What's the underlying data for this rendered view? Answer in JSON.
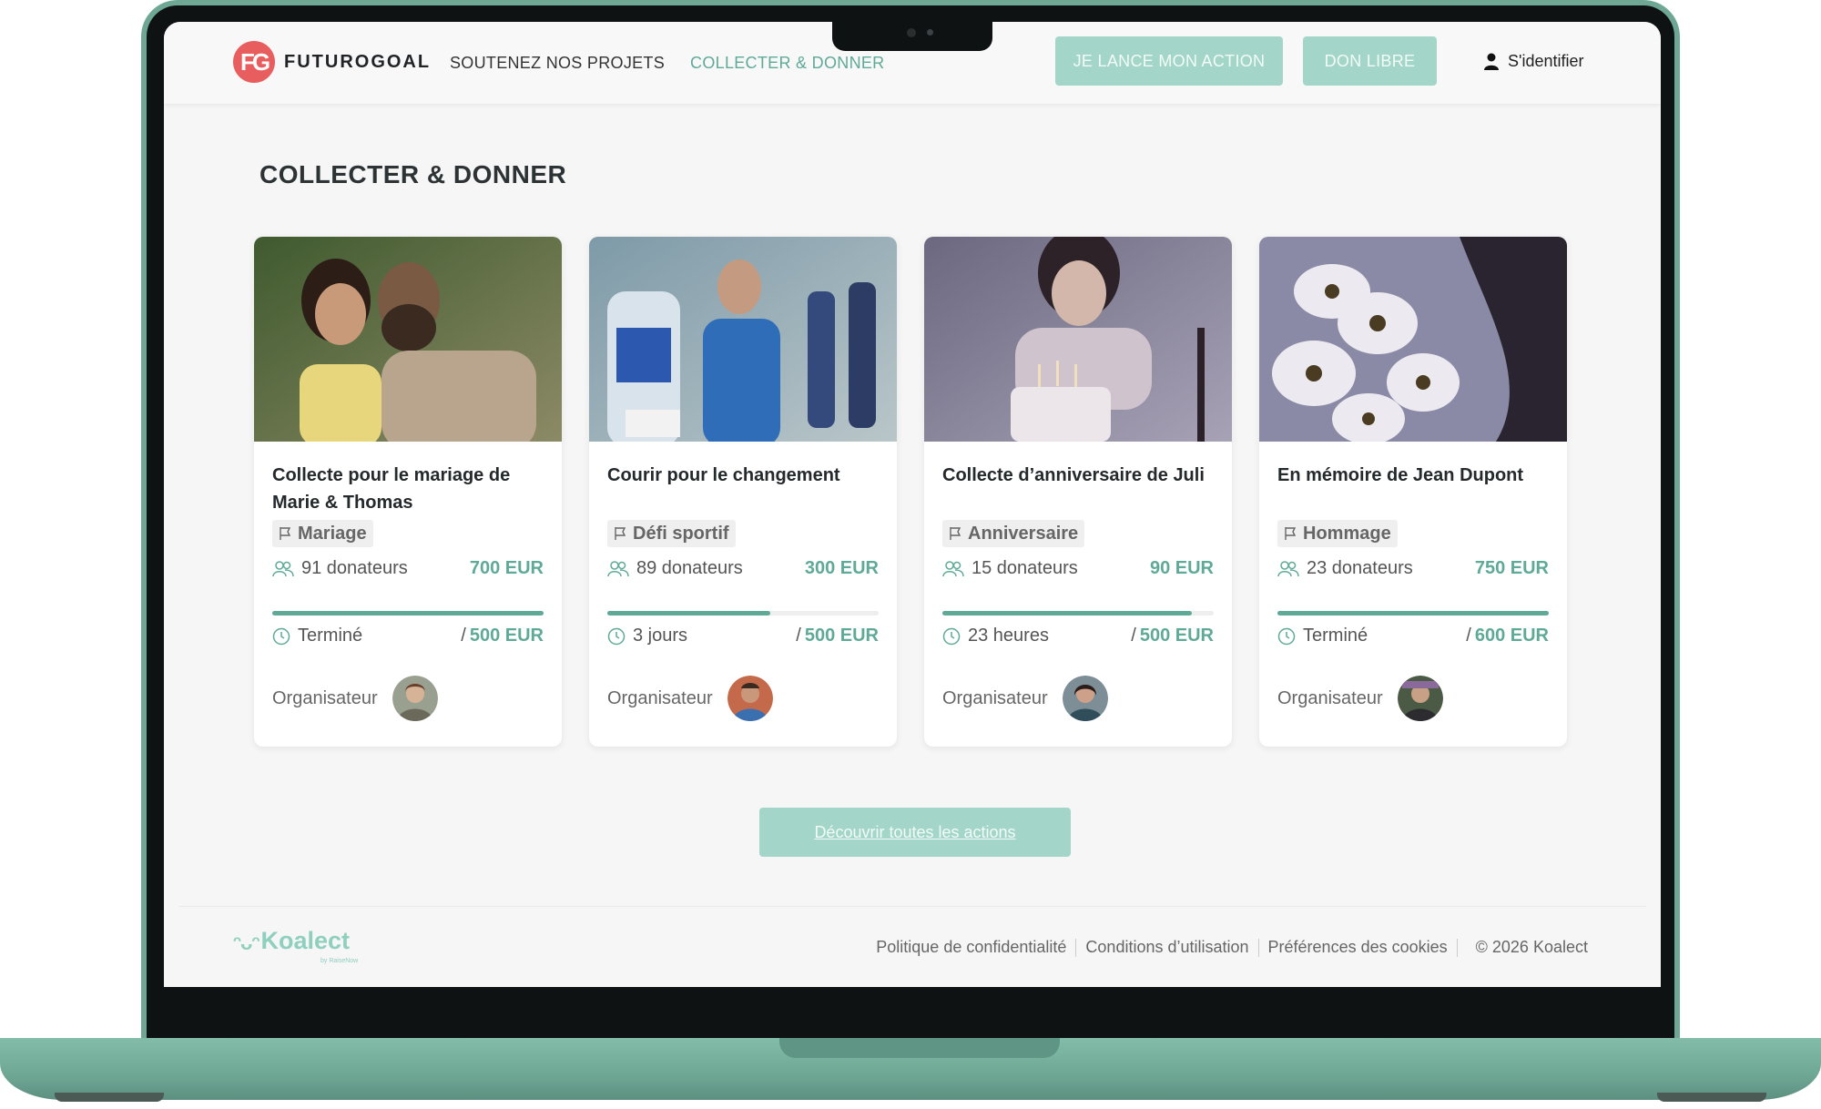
{
  "brand": {
    "name": "FUTUROGOAL",
    "mark": "FG",
    "accent": "#5faa97",
    "logo_color": "#e85d5d"
  },
  "nav": {
    "items": [
      {
        "label": "SOUTENEZ NOS PROJETS",
        "active": false
      },
      {
        "label": "COLLECTER & DONNER",
        "active": true
      }
    ]
  },
  "header": {
    "launch_button": "JE LANCE MON ACTION",
    "donate_button": "DON LIBRE",
    "login_label": "S'identifier",
    "login_icon": "user-icon"
  },
  "main": {
    "title": "COLLECTER & DONNER",
    "cards": [
      {
        "title": "Collecte pour le mariage de Marie & Thomas",
        "tag": "Mariage",
        "donors": "91 donateurs",
        "raised": "700 EUR",
        "progress": 1.0,
        "time_left": "Terminé",
        "goal": "500 EUR",
        "organizer_label": "Organisateur",
        "image": "couple-photo",
        "image_colors": [
          "#4f6b3a",
          "#c9b48c",
          "#e8d27a"
        ]
      },
      {
        "title": "Courir pour le changement",
        "tag": "Défi sportif",
        "donors": "89 donateurs",
        "raised": "300 EUR",
        "progress": 0.6,
        "time_left": "3 jours",
        "goal": "500 EUR",
        "organizer_label": "Organisateur",
        "image": "runners-photo",
        "image_colors": [
          "#4a6b84",
          "#c7d6dc",
          "#2f4fa0"
        ]
      },
      {
        "title": "Collecte d’anniversaire de Juli",
        "tag": "Anniversaire",
        "donors": "15 donateurs",
        "raised": "90 EUR",
        "progress": 0.92,
        "time_left": "23 heures",
        "goal": "500 EUR",
        "organizer_label": "Organisateur",
        "image": "birthday-photo",
        "image_colors": [
          "#5e5a70",
          "#cfc7d3",
          "#3a3138"
        ]
      },
      {
        "title": "En mémoire de Jean Dupont",
        "tag": "Hommage",
        "donors": "23 donateurs",
        "raised": "750 EUR",
        "progress": 1.0,
        "time_left": "Terminé",
        "goal": "600 EUR",
        "organizer_label": "Organisateur",
        "image": "flowers-photo",
        "image_colors": [
          "#7a7d9c",
          "#e7e6ee",
          "#2a2530"
        ]
      }
    ],
    "cta": "Découvrir toutes les actions"
  },
  "footer": {
    "logo_text": "Koalect",
    "logo_sub": "by RaiseNow",
    "links": [
      "Politique de confidentialité",
      "Conditions d’utilisation",
      "Préférences des cookies"
    ],
    "copyright": "© 2026 Koalect"
  }
}
